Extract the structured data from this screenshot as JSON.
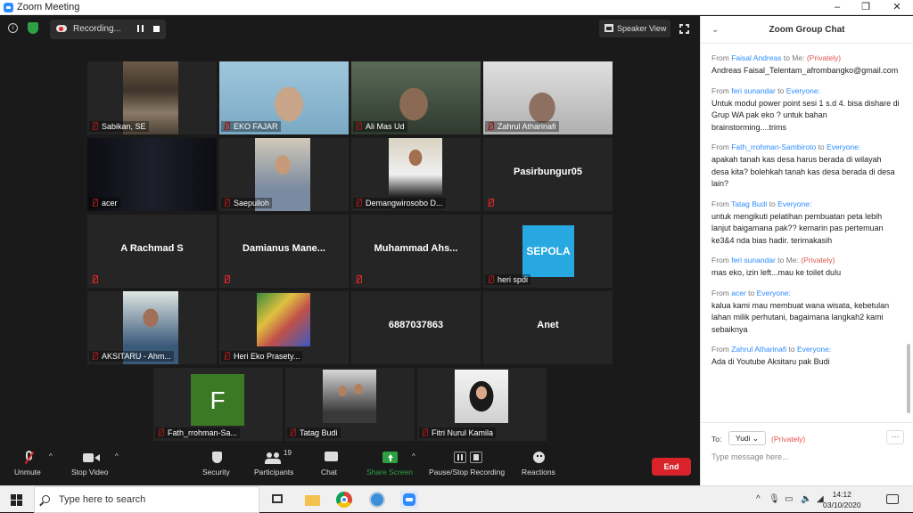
{
  "window": {
    "title": "Zoom Meeting",
    "minimize": "–",
    "maximize": "❐",
    "close": "✕"
  },
  "topbar": {
    "recording_label": "Recording...",
    "speaker_view_label": "Speaker View"
  },
  "tiles": [
    {
      "name": "Sabikan, SE"
    },
    {
      "name": "EKO FAJAR"
    },
    {
      "name": "Ali Mas Ud"
    },
    {
      "name": "Zahrul Atharinafi"
    },
    {
      "name": "acer"
    },
    {
      "name": "Saepulloh"
    },
    {
      "name": "Demangwirosobo D..."
    },
    {
      "name": "Pasirbungur05"
    },
    {
      "name": "A Rachmad S"
    },
    {
      "name": "Damianus  Mane..."
    },
    {
      "name": "Muhammad  Ahs..."
    },
    {
      "name": "heri spdi",
      "logo_text": "SEPOLA"
    },
    {
      "name": "AKSITARU - Ahm..."
    },
    {
      "name": "Heri Eko Prasety..."
    },
    {
      "name": "6887037863"
    },
    {
      "name": "Anet"
    },
    {
      "name": "Fath_rrohman-Sa...",
      "initial": "F"
    },
    {
      "name": "Tatag Budi"
    },
    {
      "name": "Fitri Nurul Kamila"
    }
  ],
  "toolbar": {
    "unmute": "Unmute",
    "stop_video": "Stop Video",
    "security": "Security",
    "participants": "Participants",
    "participants_count": "19",
    "chat": "Chat",
    "share_screen": "Share Screen",
    "pause_stop_recording": "Pause/Stop Recording",
    "reactions": "Reactions",
    "end": "End"
  },
  "chat": {
    "title": "Zoom Group Chat",
    "messages": [
      {
        "from": "Faisal Andreas",
        "to": "Me:",
        "privately": "(Privately)",
        "text": "Andreas Faisal_Telentam_afrombangko@gmail.com"
      },
      {
        "from": "feri sunandar",
        "to": "Everyone:",
        "privately": "",
        "text": "Untuk modul power point sesi 1 s.d 4. bisa dishare di Grup WA pak eko ? untuk bahan brainstorming....trims"
      },
      {
        "from": "Fath_rrohman-Sambiroto",
        "to": "Everyone:",
        "privately": "",
        "text": "apakah tanah kas desa harus berada di wilayah desa kita? bolehkah tanah kas desa berada di desa lain?"
      },
      {
        "from": "Tatag Budi",
        "to": "Everyone:",
        "privately": "",
        "text": "untuk mengikuti pelatihan pembuatan peta lebih lanjut baigamana pak?? kemarin pas pertemuan ke3&4 nda bias hadir. terimakasih"
      },
      {
        "from": "feri sunandar",
        "to": "Me:",
        "privately": "(Privately)",
        "text": "mas eko, izin left...mau ke toilet dulu"
      },
      {
        "from": "acer",
        "to": "Everyone:",
        "privately": "",
        "text": "kalua kami mau membuat wana wisata, kebetulan lahan milik perhutani, bagaimana langkah2 kami sebaiknya"
      },
      {
        "from": "Zahrul Atharinafi",
        "to": "Everyone:",
        "privately": "",
        "text": "Ada di Youtube Aksitaru pak Budi"
      }
    ],
    "from_word": "From",
    "to_word": "to",
    "to_label": "To:",
    "recipient": "Yudi",
    "recipient_mode": "(Privately)",
    "more": "···",
    "input_placeholder": "Type message here..."
  },
  "taskbar": {
    "search_placeholder": "Type here to search",
    "time": "14:12",
    "date": "03/10/2020"
  }
}
